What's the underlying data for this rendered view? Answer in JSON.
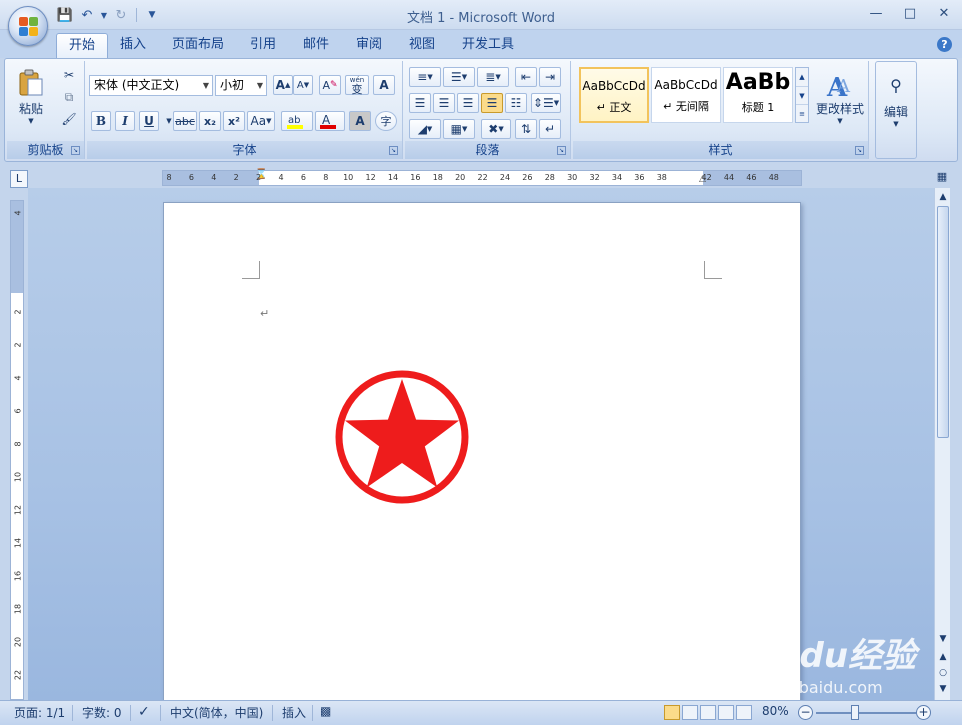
{
  "app": {
    "title": "文档 1 - Microsoft Word"
  },
  "qat": {
    "save": "save-icon",
    "undo": "undo-icon",
    "redo": "redo-icon"
  },
  "tabs": [
    {
      "label": "开始",
      "active": true
    },
    {
      "label": "插入"
    },
    {
      "label": "页面布局"
    },
    {
      "label": "引用"
    },
    {
      "label": "邮件"
    },
    {
      "label": "审阅"
    },
    {
      "label": "视图"
    },
    {
      "label": "开发工具"
    }
  ],
  "clipboard": {
    "paste_label": "粘贴",
    "group_label": "剪贴板"
  },
  "font": {
    "family": "宋体 (中文正文)",
    "size": "小初",
    "group_label": "字体",
    "bold": "B",
    "italic": "I",
    "underline": "U",
    "strike": "abc",
    "sub": "x₂",
    "sup": "x²",
    "case": "Aa",
    "grow": "A",
    "shrink": "A",
    "clear": "A",
    "wen": "wén",
    "wen_char": "变",
    "char_border": "A",
    "char_shade": "A",
    "encircle": "字"
  },
  "paragraph": {
    "group_label": "段落"
  },
  "styles": {
    "group_label": "样式",
    "items": [
      {
        "sample": "AaBbCcDd",
        "name": "↵ 正文",
        "selected": true
      },
      {
        "sample": "AaBbCcDd",
        "name": "↵ 无间隔"
      },
      {
        "sample": "AaBb",
        "name": "标题 1"
      }
    ],
    "change_label": "更改样式"
  },
  "editing": {
    "label": "编辑"
  },
  "ruler": {
    "ticks": [
      "8",
      "6",
      "4",
      "2",
      "2",
      "4",
      "6",
      "8",
      "10",
      "12",
      "14",
      "16",
      "18",
      "20",
      "22",
      "24",
      "26",
      "28",
      "30",
      "32",
      "34",
      "36",
      "38",
      "42",
      "44",
      "46",
      "48"
    ],
    "vticks": [
      "4",
      "2",
      "2",
      "4",
      "6",
      "8",
      "10",
      "12",
      "14",
      "16",
      "18",
      "20",
      "22",
      "24"
    ]
  },
  "document": {
    "para_mark": "↵"
  },
  "seal": {
    "color": "#ee1c1c"
  },
  "status": {
    "page": "页面: 1/1",
    "words": "字数: 0",
    "language": "中文(简体，中国)",
    "mode": "插入",
    "zoom": "80%",
    "zoom_level": 80
  },
  "watermark": {
    "main": "Baidu经验",
    "sub": "jingyan.baidu.com"
  }
}
